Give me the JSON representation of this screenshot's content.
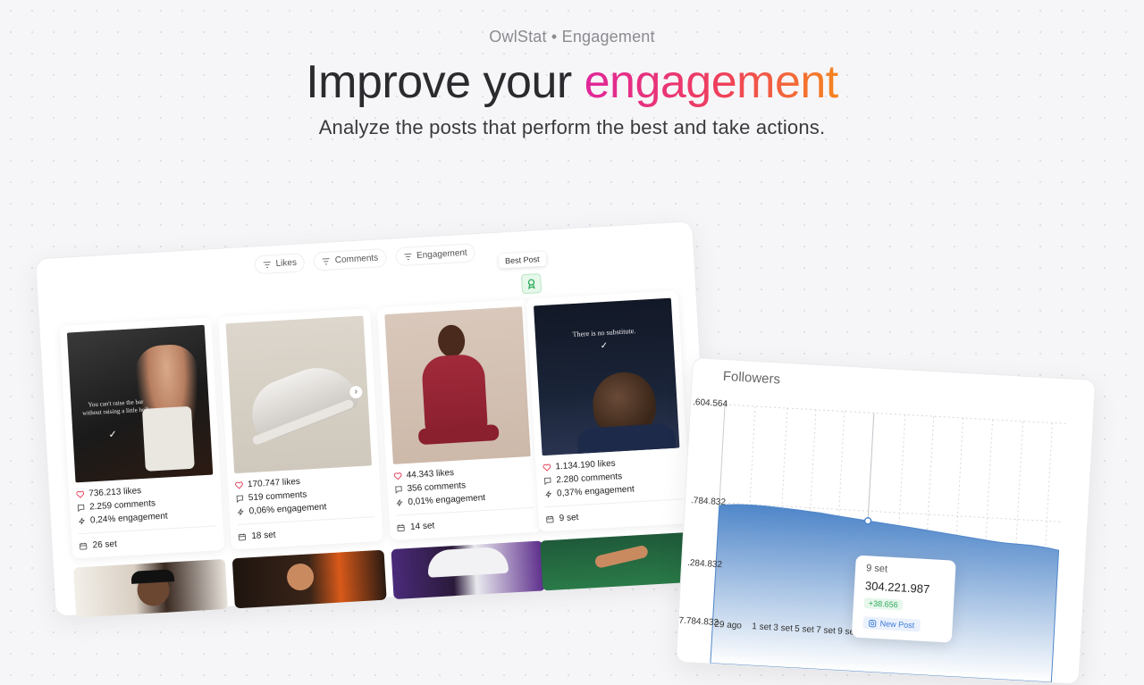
{
  "header": {
    "kicker": "OwlStat • Engagement",
    "headline_start": "Improve your ",
    "headline_accent": "engagement",
    "subtitle": "Analyze the posts that perform the best and take actions."
  },
  "posts_card": {
    "filters": [
      {
        "label": "Likes",
        "icon": "filter-icon"
      },
      {
        "label": "Comments",
        "icon": "filter-icon"
      },
      {
        "label": "Engagement",
        "icon": "filter-icon"
      }
    ],
    "best_post_label": "Best Post",
    "posts": [
      {
        "likes": "736.213 likes",
        "comments": "2.259 comments",
        "engagement": "0,24% engagement",
        "date": "26 set",
        "overlay_text": "You can't raise the bar without raising a little hell."
      },
      {
        "likes": "170.747 likes",
        "comments": "519 comments",
        "engagement": "0,06% engagement",
        "date": "18 set",
        "overlay_text": ""
      },
      {
        "likes": "44.343 likes",
        "comments": "356 comments",
        "engagement": "0,01% engagement",
        "date": "14 set",
        "overlay_text": ""
      },
      {
        "likes": "1.134.190 likes",
        "comments": "2.280 comments",
        "engagement": "0,37% engagement",
        "date": "9 set",
        "overlay_text": "There is no substitute."
      }
    ]
  },
  "followers_card": {
    "title": "Followers",
    "y_labels": [
      ".604.564",
      ".784.832",
      ".284.832",
      "7.784.832"
    ],
    "x_labels": [
      "29 ago",
      "1 set",
      "3 set",
      "5 set",
      "7 set",
      "9 set"
    ],
    "tooltip": {
      "date": "9 set",
      "value": "304.221.987",
      "delta": "+38.656",
      "action": "New Post"
    }
  },
  "colors": {
    "accent_start": "#e0269a",
    "accent_end": "#f5851f",
    "chart_fill": "#4f86c9",
    "positive": "#2eaa5a",
    "link": "#3a7ad9",
    "award": "#2eaa5a"
  }
}
